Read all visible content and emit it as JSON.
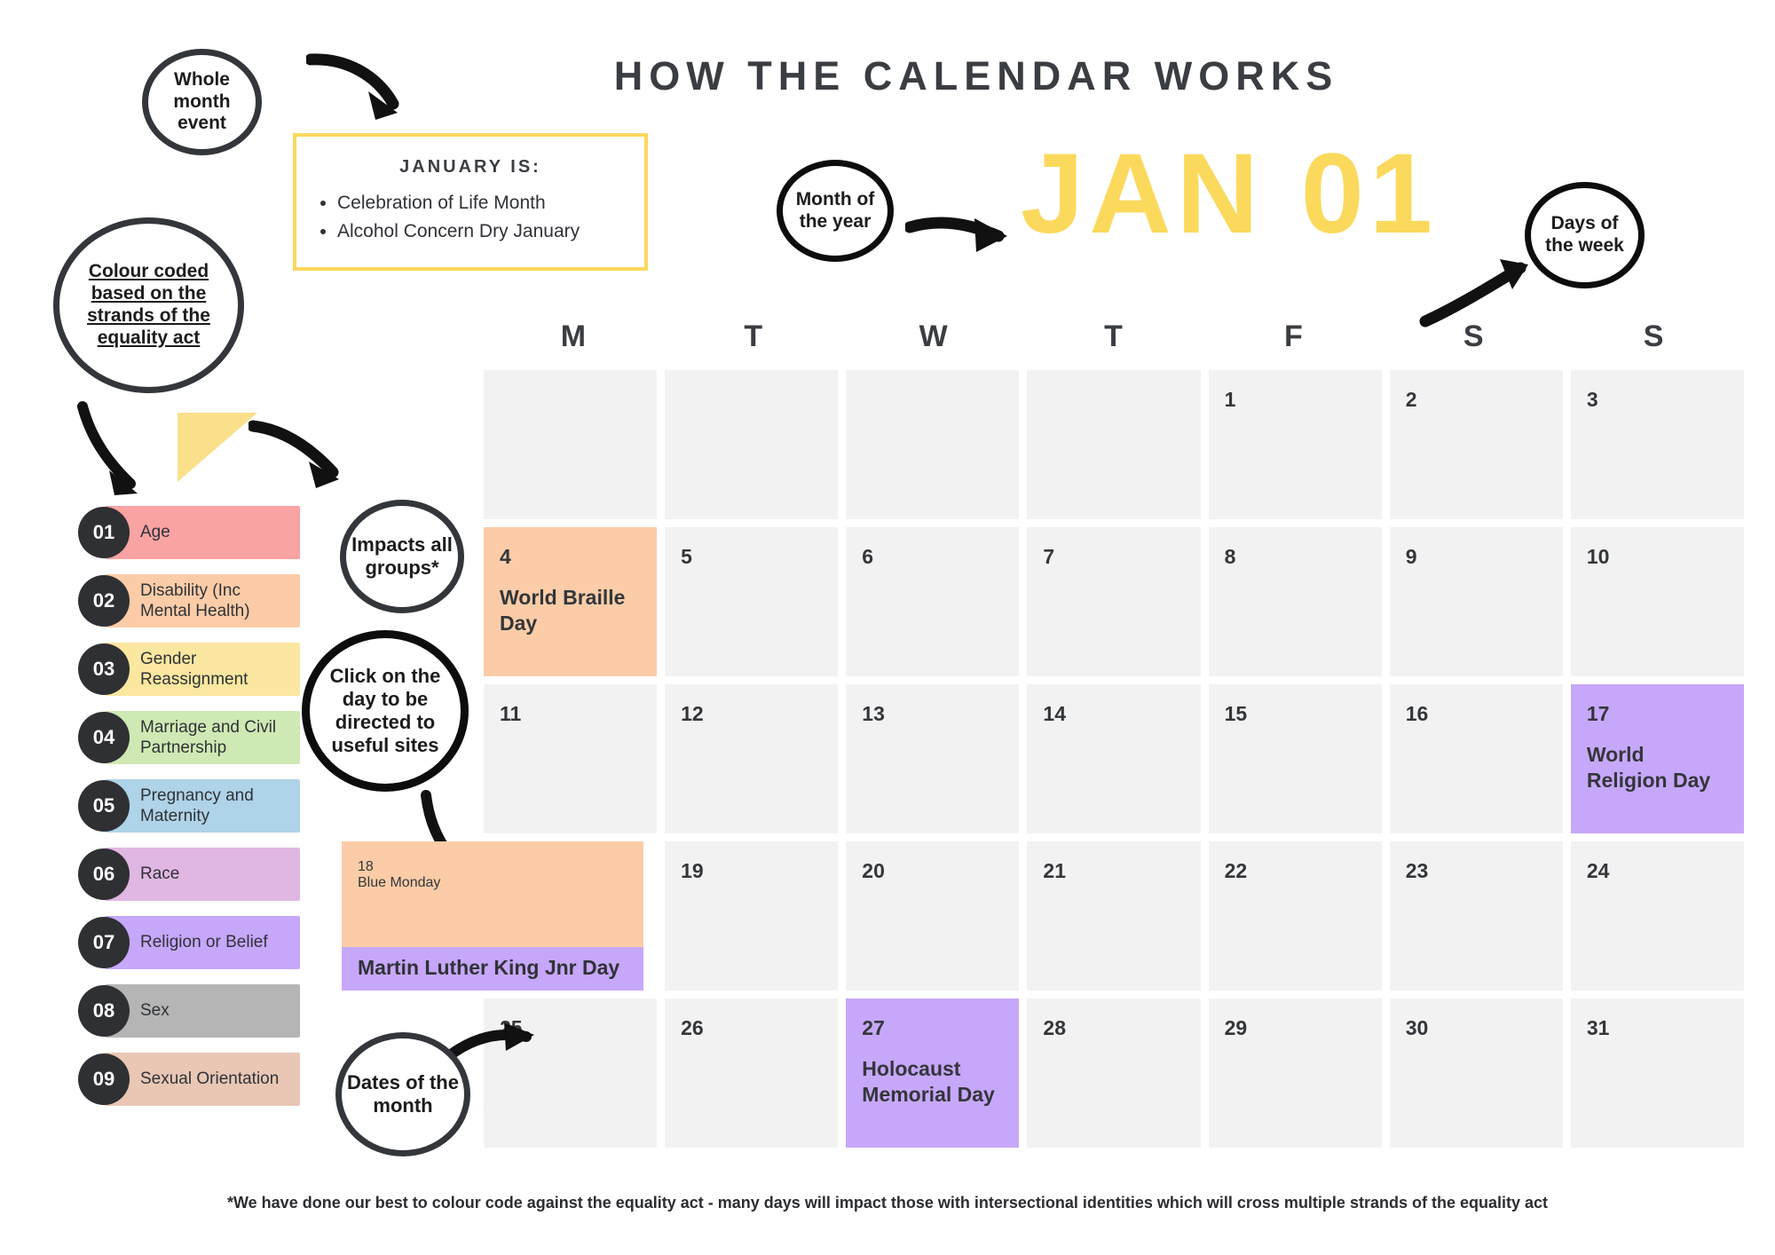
{
  "title": "HOW THE CALENDAR WORKS",
  "month_label": "JAN 01",
  "january_box": {
    "heading": "JANUARY IS:",
    "items": [
      "Celebration of Life Month",
      "Alcohol Concern Dry January"
    ]
  },
  "annotations": {
    "whole_month_event": "Whole month event",
    "colour_coded": "Colour coded based on the strands of the equality act",
    "month_of_the_year": "Month of the year",
    "days_of_the_week": "Days of the week",
    "impacts_all_groups": "Impacts all groups*",
    "click_on_the_day": "Click on the day to be directed to useful sites",
    "dates_of_the_month": "Dates of the month"
  },
  "legend": {
    "items": [
      {
        "num": "01",
        "label": "Age",
        "color": "#F9A3A3"
      },
      {
        "num": "02",
        "label": "Disability  (Inc Mental Health)",
        "color": "#FBCCA7"
      },
      {
        "num": "03",
        "label": "Gender Reassignment",
        "color": "#FBE7A0"
      },
      {
        "num": "04",
        "label": "Marriage and Civil Partnership",
        "color": "#CFE9B4"
      },
      {
        "num": "05",
        "label": "Pregnancy and Maternity",
        "color": "#AFD3E8"
      },
      {
        "num": "06",
        "label": "Race",
        "color": "#E0B6E3"
      },
      {
        "num": "07",
        "label": "Religion or Belief",
        "color": "#C7A7FA"
      },
      {
        "num": "08",
        "label": "Sex",
        "color": "#B5B5B5"
      },
      {
        "num": "09",
        "label": "Sexual Orientation",
        "color": "#E9C7B4"
      }
    ]
  },
  "calendar": {
    "day_headers": [
      "M",
      "T",
      "W",
      "T",
      "F",
      "S",
      "S"
    ],
    "cells": [
      {
        "date": "",
        "event": "",
        "color": ""
      },
      {
        "date": "",
        "event": "",
        "color": ""
      },
      {
        "date": "",
        "event": "",
        "color": ""
      },
      {
        "date": "",
        "event": "",
        "color": ""
      },
      {
        "date": "1",
        "event": "",
        "color": ""
      },
      {
        "date": "2",
        "event": "",
        "color": ""
      },
      {
        "date": "3",
        "event": "",
        "color": ""
      },
      {
        "date": "4",
        "event": "World Braille Day",
        "color": "#FBCCA7"
      },
      {
        "date": "5",
        "event": "",
        "color": ""
      },
      {
        "date": "6",
        "event": "",
        "color": ""
      },
      {
        "date": "7",
        "event": "",
        "color": ""
      },
      {
        "date": "8",
        "event": "",
        "color": ""
      },
      {
        "date": "9",
        "event": "",
        "color": ""
      },
      {
        "date": "10",
        "event": "",
        "color": ""
      },
      {
        "date": "11",
        "event": "",
        "color": ""
      },
      {
        "date": "12",
        "event": "",
        "color": ""
      },
      {
        "date": "13",
        "event": "",
        "color": ""
      },
      {
        "date": "14",
        "event": "",
        "color": ""
      },
      {
        "date": "15",
        "event": "",
        "color": ""
      },
      {
        "date": "16",
        "event": "",
        "color": ""
      },
      {
        "date": "17",
        "event": "World Religion Day",
        "color": "#C7A7FA"
      },
      {
        "date": "18",
        "event": "Blue Monday",
        "color": "#FBCCA7",
        "second_event": "Martin Luther King Jnr Day",
        "second_color": "#C7A7FA",
        "wide": true
      },
      {
        "date": "19",
        "event": "",
        "color": ""
      },
      {
        "date": "20",
        "event": "",
        "color": ""
      },
      {
        "date": "21",
        "event": "",
        "color": ""
      },
      {
        "date": "22",
        "event": "",
        "color": ""
      },
      {
        "date": "23",
        "event": "",
        "color": ""
      },
      {
        "date": "24",
        "event": "",
        "color": ""
      },
      {
        "date": "25",
        "event": "",
        "color": ""
      },
      {
        "date": "26",
        "event": "",
        "color": ""
      },
      {
        "date": "27",
        "event": "Holocaust Memorial Day",
        "color": "#C7A7FA"
      },
      {
        "date": "28",
        "event": "",
        "color": ""
      },
      {
        "date": "29",
        "event": "",
        "color": ""
      },
      {
        "date": "30",
        "event": "",
        "color": ""
      },
      {
        "date": "31",
        "event": "",
        "color": ""
      }
    ]
  },
  "footnote": "*We have done our best to colour code against the equality act - many days will impact those with intersectional identities which will cross multiple strands of the equality act"
}
